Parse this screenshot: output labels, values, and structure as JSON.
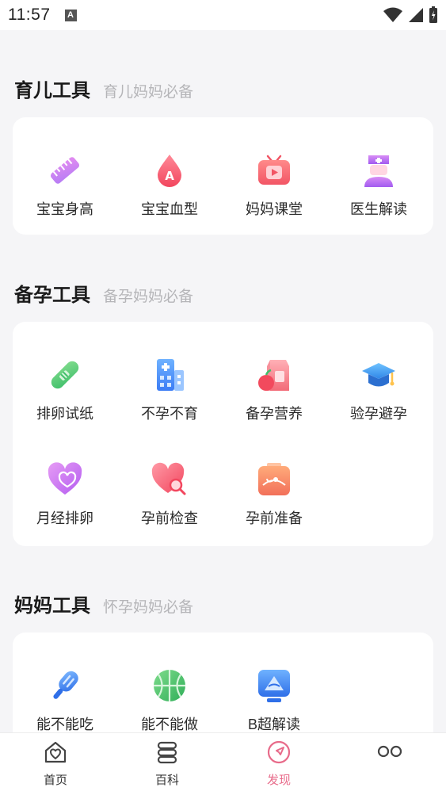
{
  "status": {
    "time": "11:57",
    "notification_glyph": "A"
  },
  "sections": [
    {
      "title": "育儿工具",
      "subtitle": "育儿妈妈必备",
      "tools": [
        {
          "label": "宝宝身高",
          "icon": "ruler-icon"
        },
        {
          "label": "宝宝血型",
          "icon": "blood-drop-icon"
        },
        {
          "label": "妈妈课堂",
          "icon": "tv-play-icon"
        },
        {
          "label": "医生解读",
          "icon": "nurse-icon"
        }
      ]
    },
    {
      "title": "备孕工具",
      "subtitle": "备孕妈妈必备",
      "tools": [
        {
          "label": "排卵试纸",
          "icon": "test-strip-icon"
        },
        {
          "label": "不孕不育",
          "icon": "hospital-icon"
        },
        {
          "label": "备孕营养",
          "icon": "nutrition-icon"
        },
        {
          "label": "验孕避孕",
          "icon": "graduation-cap-icon"
        },
        {
          "label": "月经排卵",
          "icon": "heart-icon"
        },
        {
          "label": "孕前检查",
          "icon": "heart-search-icon"
        },
        {
          "label": "孕前准备",
          "icon": "ultrasound-icon"
        }
      ]
    },
    {
      "title": "妈妈工具",
      "subtitle": "怀孕妈妈必备",
      "tools": [
        {
          "label": "能不能吃",
          "icon": "popsicle-icon"
        },
        {
          "label": "能不能做",
          "icon": "ball-icon"
        },
        {
          "label": "B超解读",
          "icon": "b-ultrasound-icon"
        }
      ]
    }
  ],
  "tabbar": {
    "items": [
      {
        "label": "首页",
        "icon": "home-icon"
      },
      {
        "label": "百科",
        "icon": "encyclopedia-icon"
      },
      {
        "label": "发现",
        "icon": "discover-icon",
        "active": true
      },
      {
        "label": "",
        "icon": "more-icon"
      }
    ]
  },
  "colors": {
    "accent": "#e86b8a",
    "background": "#f5f5f7"
  }
}
